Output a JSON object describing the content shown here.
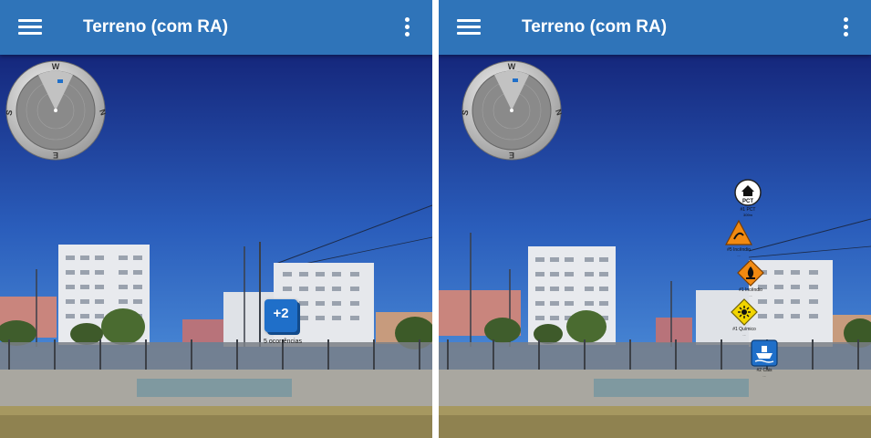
{
  "app": {
    "title": "Terreno (com RA)"
  },
  "colors": {
    "app_bar": "#2f74b9",
    "sky_top": "#15277c",
    "sky_bottom": "#4d95dd",
    "marker_blue": "#1f6fc9",
    "warning_orange": "#f28a11",
    "warning_yellow": "#f2d500"
  },
  "compass": {
    "north": "N",
    "south": "S",
    "east": "E",
    "west": "W"
  },
  "left_screen": {
    "cluster": {
      "count_label": "+2",
      "caption": "5 ocorrências"
    }
  },
  "right_screen": {
    "pois": [
      {
        "id": "pct",
        "icon": "house-icon",
        "label": "PCT",
        "caption": "#1 PCT",
        "distance": "309m"
      },
      {
        "id": "incendio-orange",
        "icon": "fire-warning-icon",
        "caption": "#5 Incêndio",
        "distance": "..."
      },
      {
        "id": "incendio-diamond",
        "icon": "flame-diamond-icon",
        "caption": "#1 Incêndio",
        "distance": "..."
      },
      {
        "id": "quimico",
        "icon": "hazard-diamond-icon",
        "caption": "#1 Químico",
        "distance": "..."
      },
      {
        "id": "cais",
        "icon": "ship-icon",
        "caption": "#2 Cais",
        "distance": "..."
      }
    ]
  }
}
